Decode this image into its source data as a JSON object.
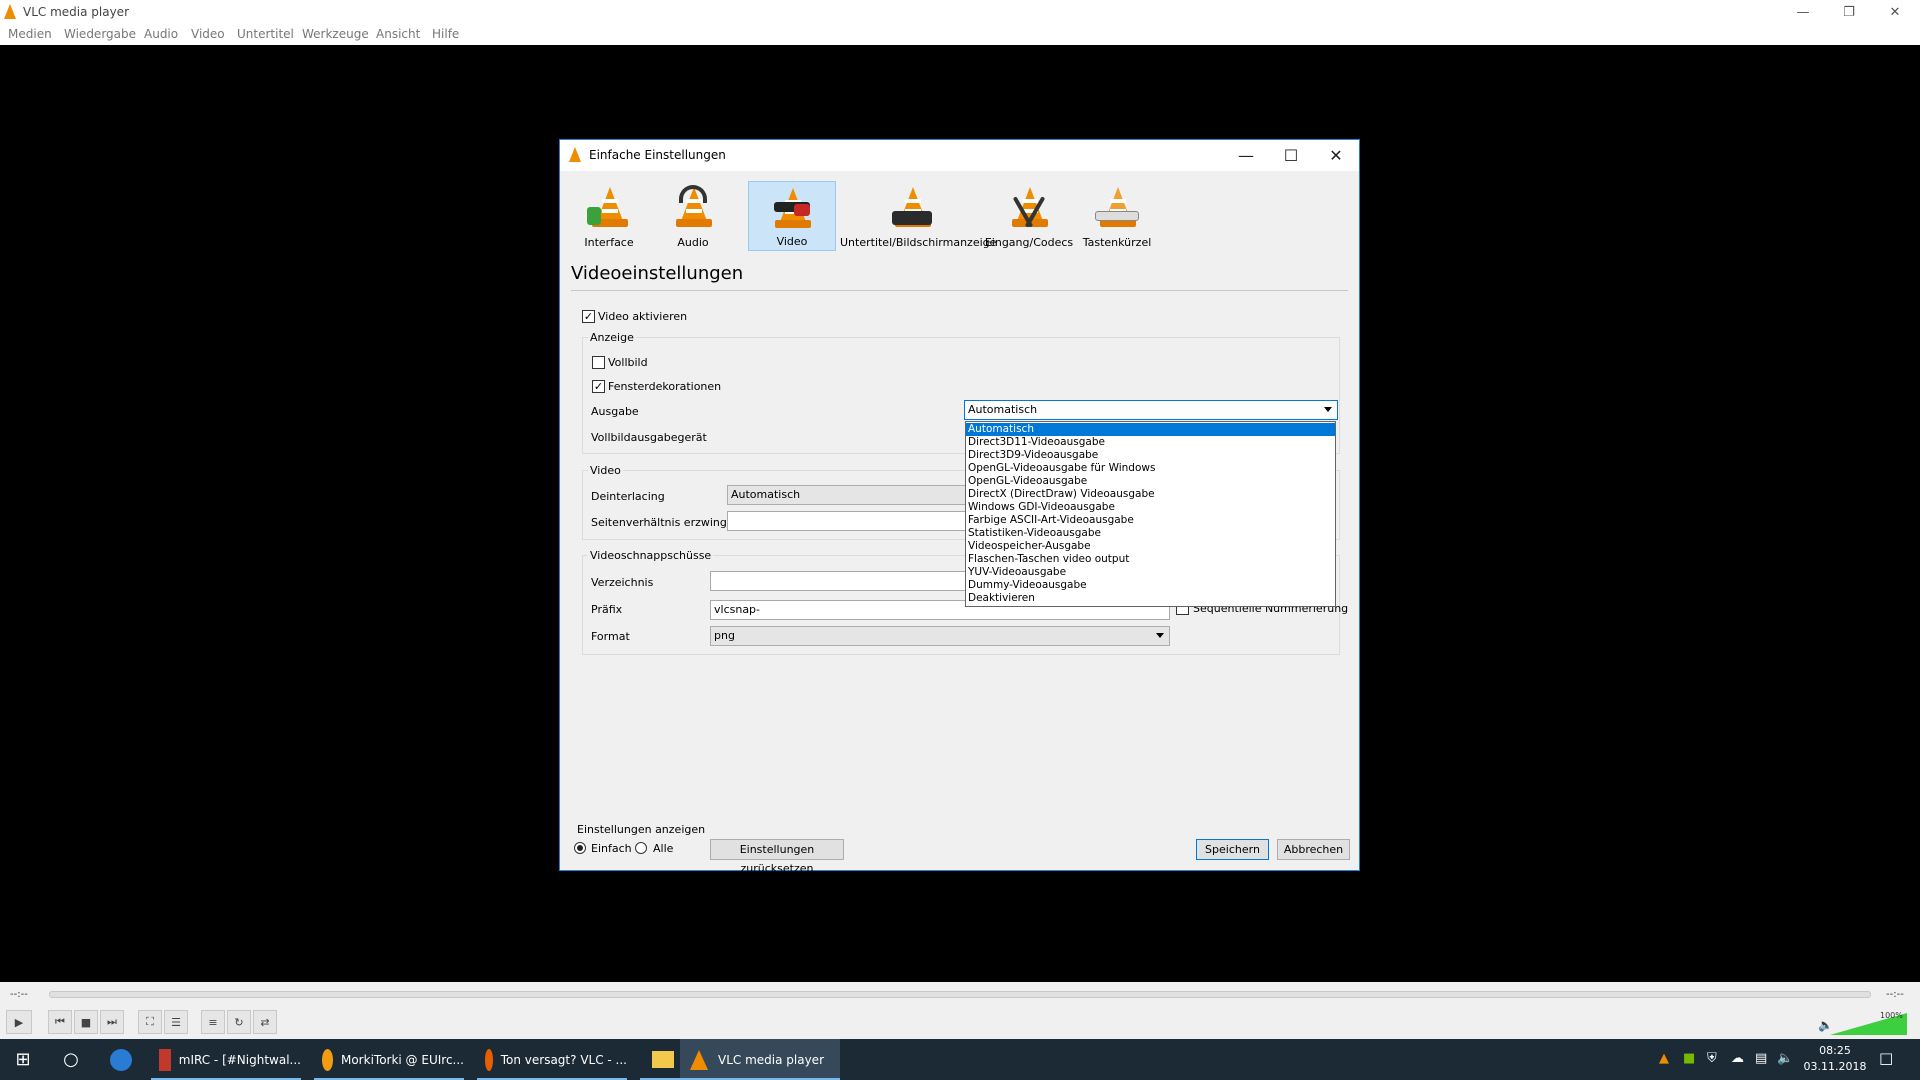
{
  "window": {
    "title": "VLC media player"
  },
  "menu": [
    "Medien",
    "Wiedergabe",
    "Audio",
    "Video",
    "Untertitel",
    "Werkzeuge",
    "Ansicht",
    "Hilfe"
  ],
  "dialog": {
    "title": "Einfache Einstellungen",
    "categories": [
      "Interface",
      "Audio",
      "Video",
      "Untertitel/Bildschirmanzeige",
      "Eingang/Codecs",
      "Tastenkürzel"
    ],
    "selected_category": "Video",
    "heading": "Videoeinstellungen",
    "video_enable": {
      "label": "Video aktivieren",
      "checked": true
    },
    "display_group": {
      "title": "Anzeige",
      "fullscreen": {
        "label": "Vollbild",
        "checked": false
      },
      "decorations": {
        "label": "Fensterdekorationen",
        "checked": true
      },
      "output_label": "Ausgabe",
      "output_value": "Automatisch",
      "fullscreen_device_label": "Vollbildausgabegerät"
    },
    "output_options": [
      "Automatisch",
      "Direct3D11-Videoausgabe",
      "Direct3D9-Videoausgabe",
      "OpenGL-Videoausgabe für Windows",
      "OpenGL-Videoausgabe",
      "DirectX (DirectDraw) Videoausgabe",
      "Windows GDI-Videoausgabe",
      "Farbige ASCII-Art-Videoausgabe",
      "Statistiken-Videoausgabe",
      "Videospeicher-Ausgabe",
      "Flaschen-Taschen video output",
      "YUV-Videoausgabe",
      "Dummy-Videoausgabe",
      "Deaktivieren"
    ],
    "video_group": {
      "title": "Video",
      "deinterlacing_label": "Deinterlacing",
      "deinterlacing_value": "Automatisch",
      "aspect_label": "Seitenverhältnis erzwingen",
      "aspect_value": ""
    },
    "snapshot_group": {
      "title": "Videoschnappschüsse",
      "dir_label": "Verzeichnis",
      "dir_value": "",
      "prefix_label": "Präfix",
      "prefix_value": "vlcsnap-",
      "sequential": {
        "label": "Sequentielle Nummerierung",
        "checked": false
      },
      "format_label": "Format",
      "format_value": "png"
    },
    "show_settings": {
      "title": "Einstellungen anzeigen",
      "simple": "Einfach",
      "all": "Alle",
      "selected": "Einfach"
    },
    "reset_label": "Einstellungen zurücksetzen",
    "save_label": "Speichern",
    "cancel_label": "Abbrechen"
  },
  "player": {
    "time_left": "--:--",
    "time_right": "--:--",
    "volume": "100%"
  },
  "taskbar": {
    "items": [
      "mIRC - [#Nightwal...",
      "MorkiTorki @ EUIrc...",
      "Ton versagt? VLC - ...",
      "VLC media player"
    ],
    "clock_time": "08:25",
    "clock_date": "03.11.2018"
  },
  "colors": {
    "accent": "#0078d7",
    "vlc_orange": "#f08c00",
    "taskbar": "#1c2a36"
  }
}
